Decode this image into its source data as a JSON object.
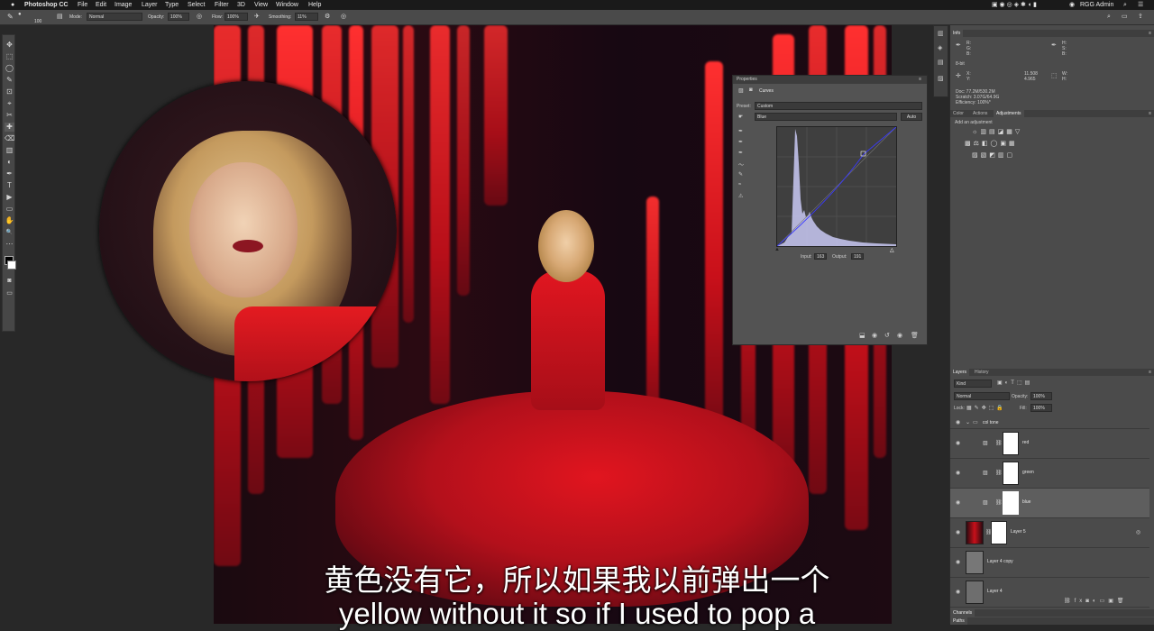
{
  "menubar": {
    "apple": "",
    "app": "Photoshop CC",
    "items": [
      "File",
      "Edit",
      "Image",
      "Layer",
      "Type",
      "Select",
      "Filter",
      "3D",
      "View",
      "Window",
      "Help"
    ],
    "user": "RGG Admin"
  },
  "options": {
    "brush_size": "100",
    "mode_label": "Mode:",
    "mode_value": "Normal",
    "opacity_label": "Opacity:",
    "opacity_value": "100%",
    "flow_label": "Flow:",
    "flow_value": "100%",
    "smoothing_label": "Smoothing:",
    "smoothing_value": "11%"
  },
  "tools": [
    "✥",
    "⬚",
    "◯",
    "✎",
    "⊡",
    "⌖",
    "✂",
    "✚",
    "⌫",
    "▥",
    "◐",
    "✒",
    "T",
    "▶",
    "▭",
    "✋",
    "🔍",
    "⋯"
  ],
  "subtitles": {
    "chinese": "黄色没有它，所以如果我以前弹出一个",
    "english": "yellow without it so if I used to pop a"
  },
  "properties": {
    "title": "Properties",
    "panel_name": "Curves",
    "preset_label": "Preset:",
    "preset_value": "Custom",
    "channel_value": "Blue",
    "auto_label": "Auto",
    "input_label": "Input:",
    "input_value": "163",
    "output_label": "Output:",
    "output_value": "191"
  },
  "info": {
    "tab": "Info",
    "r": "R:",
    "g": "G:",
    "b": "B:",
    "bit": "8-bit",
    "x_label": "X:",
    "y_label": "Y:",
    "x_value": "11.508",
    "y_value": "4.965",
    "w_label": "W:",
    "h_label": "H:",
    "doc": "Doc: 77.2M/530.2M",
    "scratch": "Scratch: 3.07G/64.9G",
    "efficiency": "Efficiency: 100%*"
  },
  "adjust_tabs": [
    "Color",
    "Actions",
    "Adjustments"
  ],
  "adjust_hint": "Add an adjustment",
  "layers_tabs": [
    "Layers",
    "History"
  ],
  "layers_filter": "Kind",
  "blend_mode": "Normal",
  "layer_opacity_label": "Opacity:",
  "layer_opacity_value": "100%",
  "lock_label": "Lock:",
  "fill_label": "Fill:",
  "fill_value": "100%",
  "group_name": "col tone",
  "layers": [
    {
      "name": "red"
    },
    {
      "name": "green"
    },
    {
      "name": "blue"
    },
    {
      "name": "Layer 5"
    },
    {
      "name": "Layer 4 copy"
    },
    {
      "name": "Layer 4"
    }
  ],
  "bottom_tabs": [
    "Channels",
    "Paths"
  ],
  "colors": {
    "accent_red": "#e1151f",
    "panel": "#535353",
    "dock": "#4b4b4b"
  }
}
